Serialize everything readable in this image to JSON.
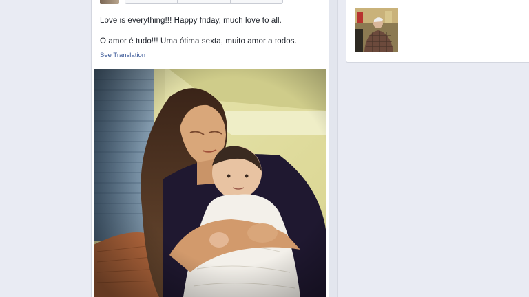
{
  "post": {
    "text_en": "Love is everything!!! Happy friday, much love to all.",
    "text_pt": "O amor é tudo!!! Uma ótima sexta, muito amor a todos.",
    "see_translation": "See Translation"
  },
  "colors": {
    "page_bg": "#e9ebf3",
    "link": "#3b5998",
    "text": "#1d2129"
  },
  "icons": {
    "top_avatar": "profile-avatar",
    "side_thumb": "photo-thumbnail"
  }
}
